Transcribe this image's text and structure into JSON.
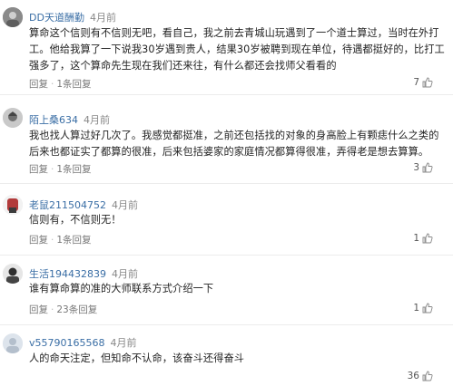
{
  "comments": [
    {
      "username": "DD天道酬勤",
      "time": "4月前",
      "text": "算命这个信则有不信则无吧，看自己，我之前去青城山玩遇到了一个道士算过，当时在外打工。他给我算了一下说我30岁遇到贵人，结果30岁被聘到现在单位，待遇都挺好的，比打工强多了，这个算命先生现在我们还来往，有什么都还会找师父看看的",
      "reply": "回复",
      "reply_count": "1条回复",
      "likes": "7"
    },
    {
      "username": "陌上桑634",
      "time": "4月前",
      "text": "我也找人算过好几次了。我感觉都挺准，之前还包括找的对象的身高脸上有颗痣什么之类的后来也都证实了都算的很准，后来包括婆家的家庭情况都算得很准，弄得老是想去算算。",
      "reply": "回复",
      "reply_count": "1条回复",
      "likes": "3"
    },
    {
      "username": "老鼠211504752",
      "time": "4月前",
      "text": "信则有，不信则无！",
      "reply": "回复",
      "reply_count": "1条回复",
      "likes": "1"
    },
    {
      "username": "生活194432839",
      "time": "4月前",
      "text": "谁有算命算的准的大师联系方式介绍一下",
      "reply": "回复",
      "reply_count": "23条回复",
      "likes": "1"
    },
    {
      "username": "v55790165568",
      "time": "4月前",
      "text": "人的命天注定，但知命不认命，该奋斗还得奋斗",
      "reply": "",
      "reply_count": "",
      "likes": "36"
    }
  ],
  "icons": {
    "like": "thumbs-up-icon",
    "avatar": "user-avatar"
  },
  "colors": {
    "username": "#3a6ea5",
    "time": "#888888",
    "text": "#222222"
  }
}
